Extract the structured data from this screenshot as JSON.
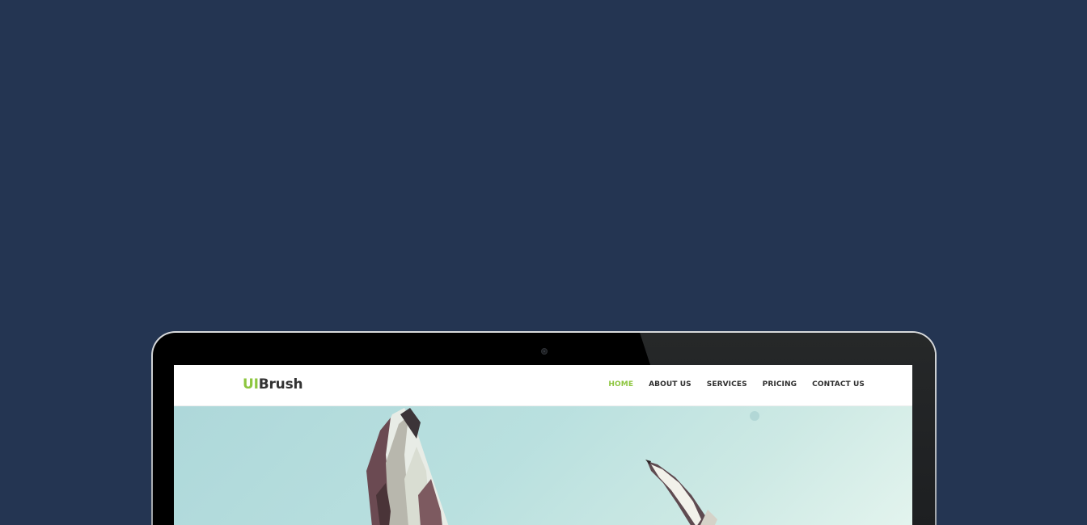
{
  "site": {
    "logo_accent": "UI",
    "logo_main": "Brush"
  },
  "nav": {
    "items": [
      {
        "label": "HOME",
        "active": true
      },
      {
        "label": "ABOUT US",
        "active": false
      },
      {
        "label": "SERVICES",
        "active": false
      },
      {
        "label": "PRICING",
        "active": false
      },
      {
        "label": "CONTACT US",
        "active": false
      }
    ]
  },
  "colors": {
    "background": "#243552",
    "accent": "#8dc63f",
    "text_dark": "#333333"
  }
}
